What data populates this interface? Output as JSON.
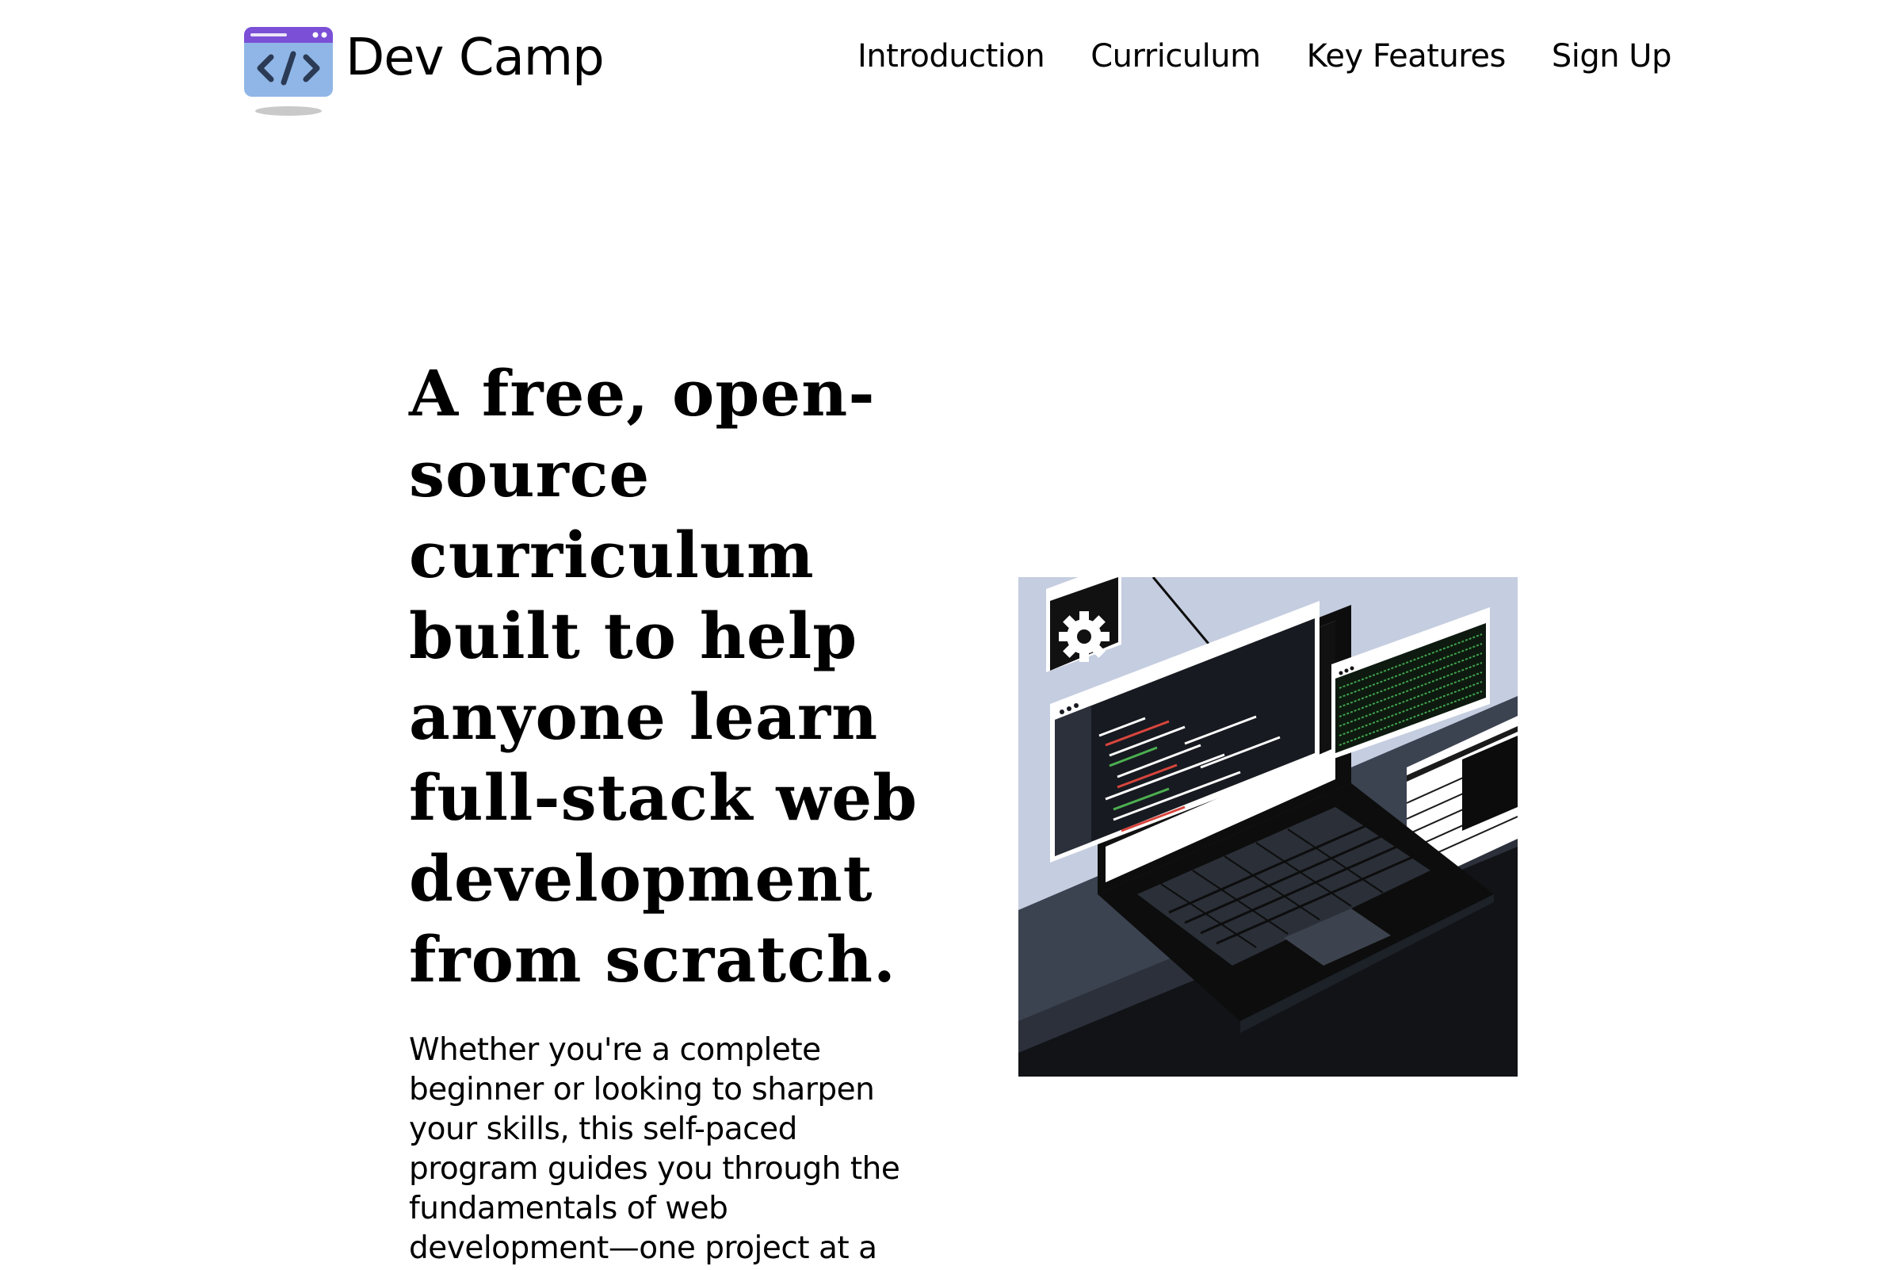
{
  "header": {
    "brand": "Dev Camp",
    "nav": [
      {
        "label": "Introduction"
      },
      {
        "label": "Curriculum"
      },
      {
        "label": "Key Features"
      },
      {
        "label": "Sign Up"
      }
    ]
  },
  "hero": {
    "title": "A free, open-source curriculum built to help anyone learn full-stack web development from scratch.",
    "description": "Whether you're a complete beginner or looking to sharpen your skills, this self-paced program guides you through the fundamentals of web development—one project at a",
    "image_icon": "laptop-code-illustration"
  },
  "colors": {
    "logo_purple": "#7b4fd6",
    "logo_blue": "#8fb6e6",
    "illustration_bg": "#c5cde0",
    "illustration_desk": "#3b4250",
    "code_red": "#d9453d",
    "code_green": "#4caf50"
  }
}
